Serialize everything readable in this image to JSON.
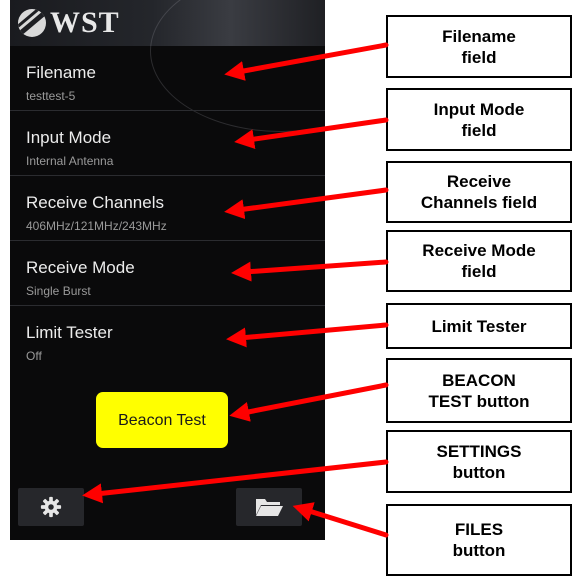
{
  "app": {
    "logo_text": "WST"
  },
  "settings": [
    {
      "title": "Filename",
      "value": "testtest-5"
    },
    {
      "title": "Input Mode",
      "value": "Internal Antenna"
    },
    {
      "title": "Receive Channels",
      "value": "406MHz/121MHz/243MHz"
    },
    {
      "title": "Receive Mode",
      "value": "Single Burst"
    },
    {
      "title": "Limit Tester",
      "value": "Off"
    }
  ],
  "beacon_button": {
    "label": "Beacon Test",
    "color": "#ffff00"
  },
  "bottom_bar": {
    "settings_icon": "gear-icon",
    "files_icon": "folder-open-icon"
  },
  "callouts": [
    {
      "label": "Filename\nfield"
    },
    {
      "label": "Input Mode\nfield"
    },
    {
      "label": "Receive\nChannels field"
    },
    {
      "label": "Receive Mode\nfield"
    },
    {
      "label": "Limit Tester"
    },
    {
      "label": "BEACON\nTEST button"
    },
    {
      "label": "SETTINGS\nbutton"
    },
    {
      "label": "FILES\nbutton"
    }
  ],
  "colors": {
    "arrow": "#ff0000",
    "screen_background": "#0a0a0b",
    "setting_title": "#ececec",
    "setting_value": "#9a9a9a"
  }
}
